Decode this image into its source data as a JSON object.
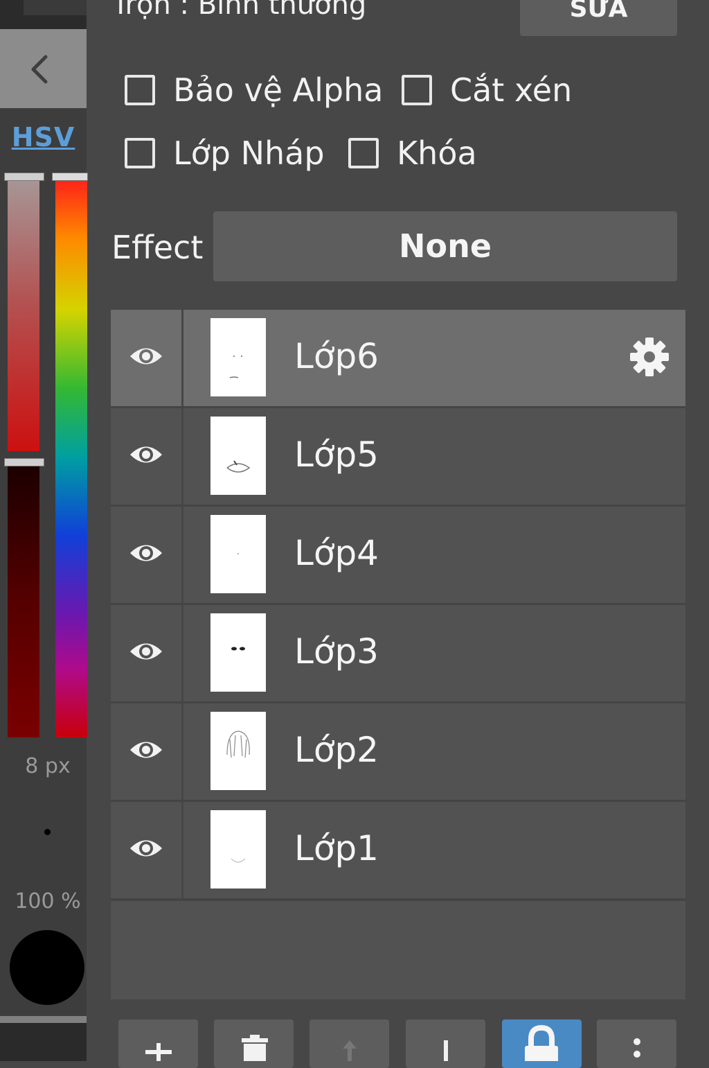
{
  "sidebar": {
    "back_icon": "chevron-left-icon",
    "color_mode_tab": "HSV",
    "brush_size": "8 px",
    "opacity": "100 %",
    "current_color": "#000000"
  },
  "header": {
    "blend_mode_label": "Trộn : Bình thường",
    "edit_button": "SỬA"
  },
  "options": {
    "alpha_protect": {
      "label": "Bảo vệ Alpha",
      "checked": false
    },
    "clipping": {
      "label": "Cắt xén",
      "checked": false
    },
    "draft_layer": {
      "label": "Lớp Nháp",
      "checked": false
    },
    "lock": {
      "label": "Khóa",
      "checked": false
    }
  },
  "effect": {
    "label": "Effect",
    "value": "None"
  },
  "layers": [
    {
      "name": "Lớp6",
      "visible": true,
      "selected": true
    },
    {
      "name": "Lớp5",
      "visible": true,
      "selected": false
    },
    {
      "name": "Lớp4",
      "visible": true,
      "selected": false
    },
    {
      "name": "Lớp3",
      "visible": true,
      "selected": false
    },
    {
      "name": "Lớp2",
      "visible": true,
      "selected": false
    },
    {
      "name": "Lớp1",
      "visible": true,
      "selected": false
    }
  ],
  "toolbar": {
    "buttons": [
      "add-layer",
      "delete-layer",
      "move-up",
      "move-down",
      "lock",
      "more"
    ],
    "active": "lock",
    "accent_color": "#4a8ac4"
  }
}
